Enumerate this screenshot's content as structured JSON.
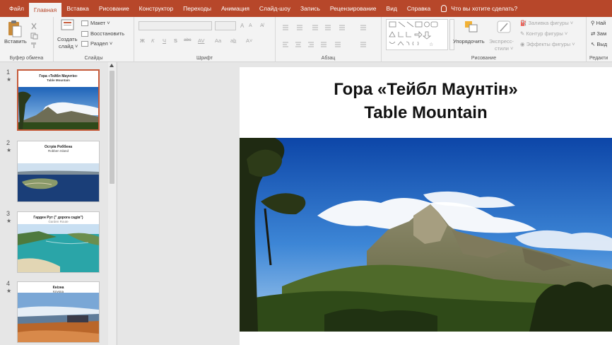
{
  "menu": {
    "tabs": [
      {
        "label": "Файл"
      },
      {
        "label": "Главная"
      },
      {
        "label": "Вставка"
      },
      {
        "label": "Рисование"
      },
      {
        "label": "Конструктор"
      },
      {
        "label": "Переходы"
      },
      {
        "label": "Анимация"
      },
      {
        "label": "Слайд-шоу"
      },
      {
        "label": "Запись"
      },
      {
        "label": "Рецензирование"
      },
      {
        "label": "Вид"
      },
      {
        "label": "Справка"
      }
    ],
    "tell_me": "Что вы хотите сделать?"
  },
  "ribbon": {
    "clipboard": {
      "paste": "Вставить",
      "group": "Буфер обмена"
    },
    "slides": {
      "new_slide_1": "Создать",
      "new_slide_2": "слайд ˅",
      "layout": "Макет ˅",
      "reset": "Восстановить",
      "section": "Раздел ˅",
      "group": "Слайды"
    },
    "font": {
      "group": "Шрифт",
      "bold": "Ж",
      "italic": "К",
      "underline": "Ч",
      "shadow": "S",
      "strike": "abc",
      "spacing": "AV",
      "case": "Aa",
      "grow": "A",
      "shrink": "A"
    },
    "paragraph": {
      "group": "Абзац"
    },
    "drawing": {
      "arrange": "Упорядочить",
      "quick_styles_1": "Экспресс-",
      "quick_styles_2": "стили ˅",
      "fill": "Заливка фигуры ˅",
      "outline": "Контур фигуры ˅",
      "effects": "Эффекты фигуры ˅",
      "group": "Рисование"
    },
    "editing": {
      "find": "Най",
      "replace": "Зам",
      "select": "Выд",
      "group": "Редакти"
    }
  },
  "slides": [
    {
      "number": "1",
      "title": "Гора «Тейбл Маунтін»",
      "subtitle": "Table Mountain"
    },
    {
      "number": "2",
      "title": "Острів Роббена",
      "subtitle": "Robben Island"
    },
    {
      "number": "3",
      "title": "Гарден Рут (\" дорога садів\")",
      "subtitle": "Garden Route"
    },
    {
      "number": "4",
      "title": "Кнізна",
      "subtitle": "Knysna"
    }
  ],
  "current_slide": {
    "title_line1": "Гора «Тейбл Маунтін»",
    "title_line2": "Table Mountain"
  },
  "colors": {
    "accent": "#b7472a",
    "selected_border": "#c55a3a"
  }
}
